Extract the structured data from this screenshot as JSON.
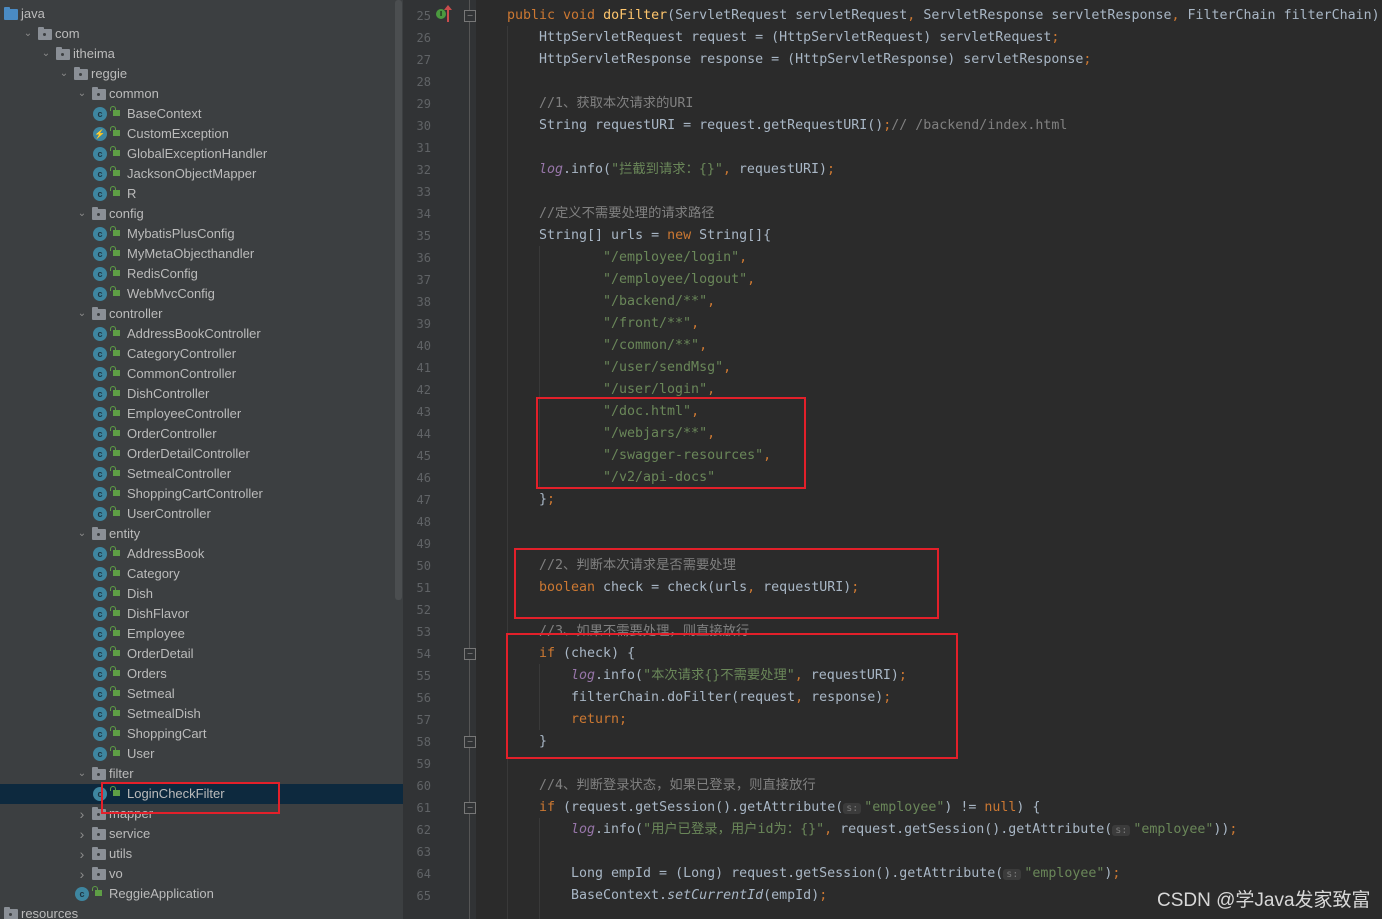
{
  "project_tree": {
    "items": [
      {
        "label": "java",
        "type": "source-folder",
        "depth": 0,
        "expanded": null
      },
      {
        "label": "com",
        "type": "package",
        "depth": 1,
        "expanded": true
      },
      {
        "label": "itheima",
        "type": "package",
        "depth": 2,
        "expanded": true
      },
      {
        "label": "reggie",
        "type": "package",
        "depth": 3,
        "expanded": true
      },
      {
        "label": "common",
        "type": "package",
        "depth": 4,
        "expanded": true
      },
      {
        "label": "BaseContext",
        "type": "class",
        "depth": 5
      },
      {
        "label": "CustomException",
        "type": "exception",
        "depth": 5
      },
      {
        "label": "GlobalExceptionHandler",
        "type": "class",
        "depth": 5
      },
      {
        "label": "JacksonObjectMapper",
        "type": "class",
        "depth": 5
      },
      {
        "label": "R",
        "type": "class",
        "depth": 5
      },
      {
        "label": "config",
        "type": "package",
        "depth": 4,
        "expanded": true
      },
      {
        "label": "MybatisPlusConfig",
        "type": "class",
        "depth": 5
      },
      {
        "label": "MyMetaObjecthandler",
        "type": "class",
        "depth": 5
      },
      {
        "label": "RedisConfig",
        "type": "class",
        "depth": 5
      },
      {
        "label": "WebMvcConfig",
        "type": "class",
        "depth": 5
      },
      {
        "label": "controller",
        "type": "package",
        "depth": 4,
        "expanded": true
      },
      {
        "label": "AddressBookController",
        "type": "class",
        "depth": 5
      },
      {
        "label": "CategoryController",
        "type": "class",
        "depth": 5
      },
      {
        "label": "CommonController",
        "type": "class",
        "depth": 5
      },
      {
        "label": "DishController",
        "type": "class",
        "depth": 5
      },
      {
        "label": "EmployeeController",
        "type": "class",
        "depth": 5
      },
      {
        "label": "OrderController",
        "type": "class",
        "depth": 5
      },
      {
        "label": "OrderDetailController",
        "type": "class",
        "depth": 5
      },
      {
        "label": "SetmealController",
        "type": "class",
        "depth": 5
      },
      {
        "label": "ShoppingCartController",
        "type": "class",
        "depth": 5
      },
      {
        "label": "UserController",
        "type": "class",
        "depth": 5
      },
      {
        "label": "entity",
        "type": "package",
        "depth": 4,
        "expanded": true
      },
      {
        "label": "AddressBook",
        "type": "class",
        "depth": 5
      },
      {
        "label": "Category",
        "type": "class",
        "depth": 5
      },
      {
        "label": "Dish",
        "type": "class",
        "depth": 5
      },
      {
        "label": "DishFlavor",
        "type": "class",
        "depth": 5
      },
      {
        "label": "Employee",
        "type": "class",
        "depth": 5
      },
      {
        "label": "OrderDetail",
        "type": "class",
        "depth": 5
      },
      {
        "label": "Orders",
        "type": "class",
        "depth": 5
      },
      {
        "label": "Setmeal",
        "type": "class",
        "depth": 5
      },
      {
        "label": "SetmealDish",
        "type": "class",
        "depth": 5
      },
      {
        "label": "ShoppingCart",
        "type": "class",
        "depth": 5
      },
      {
        "label": "User",
        "type": "class",
        "depth": 5
      },
      {
        "label": "filter",
        "type": "package",
        "depth": 4,
        "expanded": true
      },
      {
        "label": "LoginCheckFilter",
        "type": "class",
        "depth": 5,
        "selected": true
      },
      {
        "label": "mapper",
        "type": "package",
        "depth": 4,
        "expanded": false
      },
      {
        "label": "service",
        "type": "package",
        "depth": 4,
        "expanded": false
      },
      {
        "label": "utils",
        "type": "package",
        "depth": 4,
        "expanded": false
      },
      {
        "label": "vo",
        "type": "package",
        "depth": 4,
        "expanded": false
      },
      {
        "label": "ReggieApplication",
        "type": "app-class",
        "depth": 4
      },
      {
        "label": "resources",
        "type": "resource-folder",
        "depth": 0,
        "expanded": null
      }
    ]
  },
  "editor": {
    "lines": [
      {
        "n": "25",
        "tokens": [
          [
            "kw",
            "public void "
          ],
          [
            "fn",
            "doFilter"
          ],
          [
            "",
            "(ServletRequest servletRequest"
          ],
          [
            "kw",
            ", "
          ],
          [
            "",
            "ServletResponse servletResponse"
          ],
          [
            "kw",
            ", "
          ],
          [
            "",
            "FilterChain filterChain) {"
          ]
        ],
        "indent": 1
      },
      {
        "n": "26",
        "tokens": [
          [
            "",
            "HttpServletRequest request = (HttpServletRequest) servletRequest"
          ],
          [
            "kw",
            ";"
          ]
        ],
        "indent": 2
      },
      {
        "n": "27",
        "tokens": [
          [
            "",
            "HttpServletResponse response = (HttpServletResponse) servletResponse"
          ],
          [
            "kw",
            ";"
          ]
        ],
        "indent": 2
      },
      {
        "n": "28",
        "tokens": [],
        "indent": 2
      },
      {
        "n": "29",
        "tokens": [
          [
            "cmt",
            "//1、获取本次请求的URI"
          ]
        ],
        "indent": 2
      },
      {
        "n": "30",
        "tokens": [
          [
            "",
            "String requestURI = request.getRequestURI()"
          ],
          [
            "kw",
            ";"
          ],
          [
            "cmt",
            "// /backend/index.html"
          ]
        ],
        "indent": 2
      },
      {
        "n": "31",
        "tokens": [],
        "indent": 2
      },
      {
        "n": "32",
        "tokens": [
          [
            "log",
            "log"
          ],
          [
            "",
            ".info("
          ],
          [
            "str",
            "\"拦截到请求：{}\""
          ],
          [
            "kw",
            ", "
          ],
          [
            "",
            "requestURI)"
          ],
          [
            "kw",
            ";"
          ]
        ],
        "indent": 2
      },
      {
        "n": "33",
        "tokens": [],
        "indent": 2
      },
      {
        "n": "34",
        "tokens": [
          [
            "cmt",
            "//定义不需要处理的请求路径"
          ]
        ],
        "indent": 2
      },
      {
        "n": "35",
        "tokens": [
          [
            "",
            "String[] urls = "
          ],
          [
            "kw",
            "new "
          ],
          [
            "",
            "String[]{"
          ]
        ],
        "indent": 2
      },
      {
        "n": "36",
        "tokens": [
          [
            "str",
            "\"/employee/login\""
          ],
          [
            "kw",
            ","
          ]
        ],
        "indent": 4
      },
      {
        "n": "37",
        "tokens": [
          [
            "str",
            "\"/employee/logout\""
          ],
          [
            "kw",
            ","
          ]
        ],
        "indent": 4
      },
      {
        "n": "38",
        "tokens": [
          [
            "str",
            "\"/backend/**\""
          ],
          [
            "kw",
            ","
          ]
        ],
        "indent": 4
      },
      {
        "n": "39",
        "tokens": [
          [
            "str",
            "\"/front/**\""
          ],
          [
            "kw",
            ","
          ]
        ],
        "indent": 4
      },
      {
        "n": "40",
        "tokens": [
          [
            "str",
            "\"/common/**\""
          ],
          [
            "kw",
            ","
          ]
        ],
        "indent": 4
      },
      {
        "n": "41",
        "tokens": [
          [
            "str",
            "\"/user/sendMsg\""
          ],
          [
            "kw",
            ","
          ]
        ],
        "indent": 4
      },
      {
        "n": "42",
        "tokens": [
          [
            "str",
            "\"/user/login\""
          ],
          [
            "kw",
            ","
          ]
        ],
        "indent": 4
      },
      {
        "n": "43",
        "tokens": [
          [
            "str",
            "\"/doc.html\""
          ],
          [
            "kw",
            ","
          ]
        ],
        "indent": 4
      },
      {
        "n": "44",
        "tokens": [
          [
            "str",
            "\"/webjars/**\""
          ],
          [
            "kw",
            ","
          ]
        ],
        "indent": 4
      },
      {
        "n": "45",
        "tokens": [
          [
            "str",
            "\"/swagger-resources\""
          ],
          [
            "kw",
            ","
          ]
        ],
        "indent": 4
      },
      {
        "n": "46",
        "tokens": [
          [
            "str",
            "\"/v2/api-docs\""
          ]
        ],
        "indent": 4
      },
      {
        "n": "47",
        "tokens": [
          [
            "",
            "}"
          ],
          [
            "kw",
            ";"
          ]
        ],
        "indent": 2
      },
      {
        "n": "48",
        "tokens": [],
        "indent": 2
      },
      {
        "n": "49",
        "tokens": [],
        "indent": 2
      },
      {
        "n": "50",
        "tokens": [
          [
            "cmt",
            "//2、判断本次请求是否需要处理"
          ]
        ],
        "indent": 2
      },
      {
        "n": "51",
        "tokens": [
          [
            "kw",
            "boolean "
          ],
          [
            "",
            "check = check(urls"
          ],
          [
            "kw",
            ", "
          ],
          [
            "",
            "requestURI)"
          ],
          [
            "kw",
            ";"
          ]
        ],
        "indent": 2
      },
      {
        "n": "52",
        "tokens": [],
        "indent": 2
      },
      {
        "n": "53",
        "tokens": [
          [
            "cmt",
            "//3、如果不需要处理，则直接放行"
          ]
        ],
        "indent": 2
      },
      {
        "n": "54",
        "tokens": [
          [
            "kw",
            "if "
          ],
          [
            "",
            "(check) {"
          ]
        ],
        "indent": 2
      },
      {
        "n": "55",
        "tokens": [
          [
            "log",
            "log"
          ],
          [
            "",
            ".info("
          ],
          [
            "str",
            "\"本次请求{}不需要处理\""
          ],
          [
            "kw",
            ", "
          ],
          [
            "",
            "requestURI)"
          ],
          [
            "kw",
            ";"
          ]
        ],
        "indent": 3
      },
      {
        "n": "56",
        "tokens": [
          [
            "",
            "filterChain.doFilter(request"
          ],
          [
            "kw",
            ", "
          ],
          [
            "",
            "response)"
          ],
          [
            "kw",
            ";"
          ]
        ],
        "indent": 3
      },
      {
        "n": "57",
        "tokens": [
          [
            "kw",
            "return;"
          ]
        ],
        "indent": 3
      },
      {
        "n": "58",
        "tokens": [
          [
            "",
            "}"
          ]
        ],
        "indent": 2
      },
      {
        "n": "59",
        "tokens": [],
        "indent": 2
      },
      {
        "n": "60",
        "tokens": [
          [
            "cmt",
            "//4、判断登录状态，如果已登录，则直接放行"
          ]
        ],
        "indent": 2
      },
      {
        "n": "61",
        "tokens": [
          [
            "kw",
            "if "
          ],
          [
            "",
            "(request.getSession().getAttribute("
          ],
          [
            "hint",
            "s:"
          ],
          [
            "str",
            "\"employee\""
          ],
          [
            "",
            ") != "
          ],
          [
            "kw",
            "null"
          ],
          [
            "",
            ") {"
          ]
        ],
        "indent": 2
      },
      {
        "n": "62",
        "tokens": [
          [
            "log",
            "log"
          ],
          [
            "",
            ".info("
          ],
          [
            "str",
            "\"用户已登录，用户id为：{}\""
          ],
          [
            "kw",
            ", "
          ],
          [
            "",
            "request.getSession().getAttribute("
          ],
          [
            "hint",
            "s:"
          ],
          [
            "str",
            "\"employee\""
          ],
          [
            "",
            "))"
          ],
          [
            "kw",
            ";"
          ]
        ],
        "indent": 3
      },
      {
        "n": "63",
        "tokens": [],
        "indent": 3
      },
      {
        "n": "64",
        "tokens": [
          [
            "",
            "Long empId = (Long) request.getSession().getAttribute("
          ],
          [
            "hint",
            "s:"
          ],
          [
            "str",
            "\"employee\""
          ],
          [
            "",
            ")"
          ],
          [
            "kw",
            ";"
          ]
        ],
        "indent": 3
      },
      {
        "n": "65",
        "tokens": [
          [
            "",
            "BaseContext."
          ],
          [
            "ital",
            "setCurrentId"
          ],
          [
            "",
            "(empId)"
          ],
          [
            "kw",
            ";"
          ]
        ],
        "indent": 3
      }
    ]
  },
  "watermark": "CSDN @学Java发家致富"
}
